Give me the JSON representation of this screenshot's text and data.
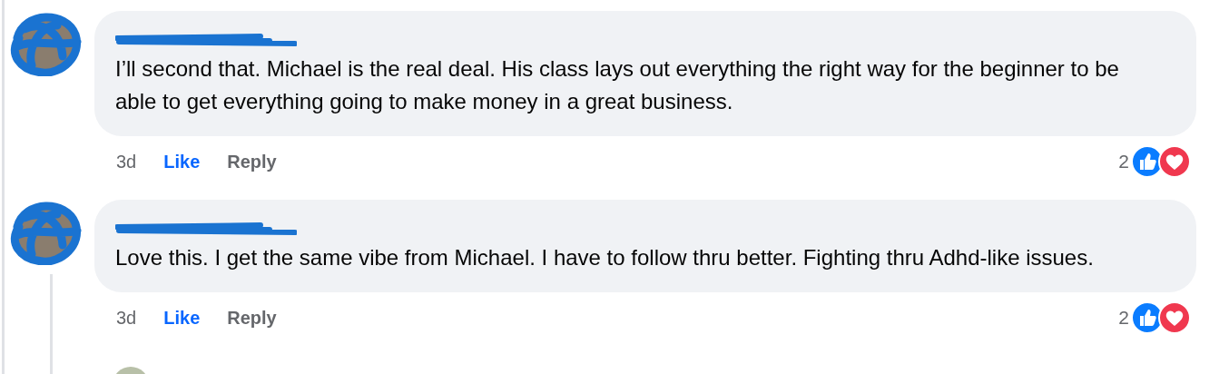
{
  "comments": [
    {
      "text": "I’ll second that. Michael is the real deal. His class lays out everything the right way for the beginner to be able to get everything going to make money in a great business.",
      "time": "3d",
      "like": "Like",
      "liked": true,
      "reply": "Reply",
      "reaction_count": "2",
      "reactions": [
        {
          "kind": "like"
        },
        {
          "kind": "love"
        }
      ],
      "thread_line": false
    },
    {
      "text": "Love this. I get the same vibe from Michael. I have to follow thru better. Fighting thru Adhd-like issues.",
      "time": "3d",
      "like": "Like",
      "liked": true,
      "reply": "Reply",
      "reaction_count": "2",
      "reactions": [
        {
          "kind": "like"
        },
        {
          "kind": "love"
        }
      ],
      "thread_line": true
    }
  ]
}
